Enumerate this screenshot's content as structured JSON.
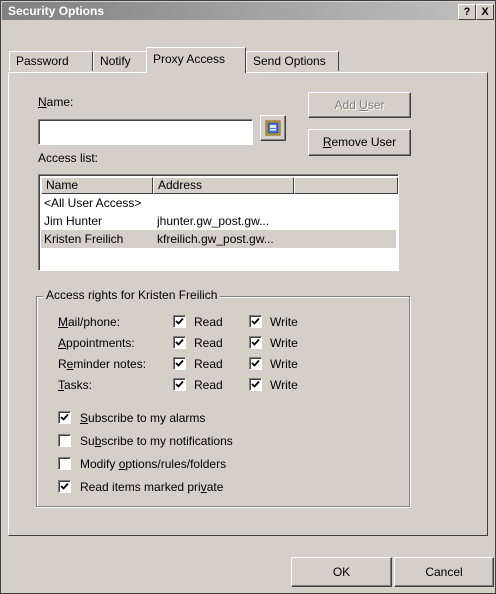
{
  "window": {
    "title": "Security Options",
    "help_glyph": "?",
    "close_glyph": "X"
  },
  "tabs": [
    {
      "label": "Password",
      "active": false
    },
    {
      "label": "Notify",
      "active": false
    },
    {
      "label": "Proxy Access",
      "active": true
    },
    {
      "label": "Send Options",
      "active": false
    }
  ],
  "name_field": {
    "label_access_key": "N",
    "label_rest": "ame:",
    "value": ""
  },
  "buttons": {
    "add_user_pre": "Add ",
    "add_user_key": "U",
    "add_user_post": "ser",
    "remove_user_key": "R",
    "remove_user_post": "emove User",
    "ok": "OK",
    "cancel": "Cancel"
  },
  "access_list": {
    "label": "Access list:",
    "columns": [
      "Name",
      "Address"
    ],
    "rows": [
      {
        "name": "<All User Access>",
        "address": "",
        "selected": false
      },
      {
        "name": "Jim Hunter",
        "address": "jhunter.gw_post.gw...",
        "selected": false
      },
      {
        "name": "Kristen Freilich",
        "address": "kfreilich.gw_post.gw...",
        "selected": true
      }
    ]
  },
  "rights": {
    "legend": "Access rights for Kristen Freilich",
    "rows": [
      {
        "key": "M",
        "rest": "ail/phone:",
        "read_label": "Read",
        "write_label": "Write",
        "read": true,
        "write": true
      },
      {
        "key": "A",
        "rest": "ppointments:",
        "read_label": "Read",
        "write_label": "Write",
        "read": true,
        "write": true
      },
      {
        "pre": "R",
        "key": "e",
        "rest": "minder notes:",
        "read_label": "Read",
        "write_label": "Write",
        "read": true,
        "write": true
      },
      {
        "key": "T",
        "rest": "asks:",
        "read_label": "Read",
        "write_label": "Write",
        "read": true,
        "write": true
      }
    ],
    "options": [
      {
        "pre": "",
        "key": "S",
        "post": "ubscribe to my alarms",
        "checked": true
      },
      {
        "pre": "Su",
        "key": "b",
        "post": "scribe to my notifications",
        "checked": false
      },
      {
        "pre": "Modify ",
        "key": "o",
        "post": "ptions/rules/folders",
        "checked": false
      },
      {
        "pre": "Read items marked pri",
        "key": "v",
        "post": "ate",
        "checked": true
      }
    ]
  }
}
